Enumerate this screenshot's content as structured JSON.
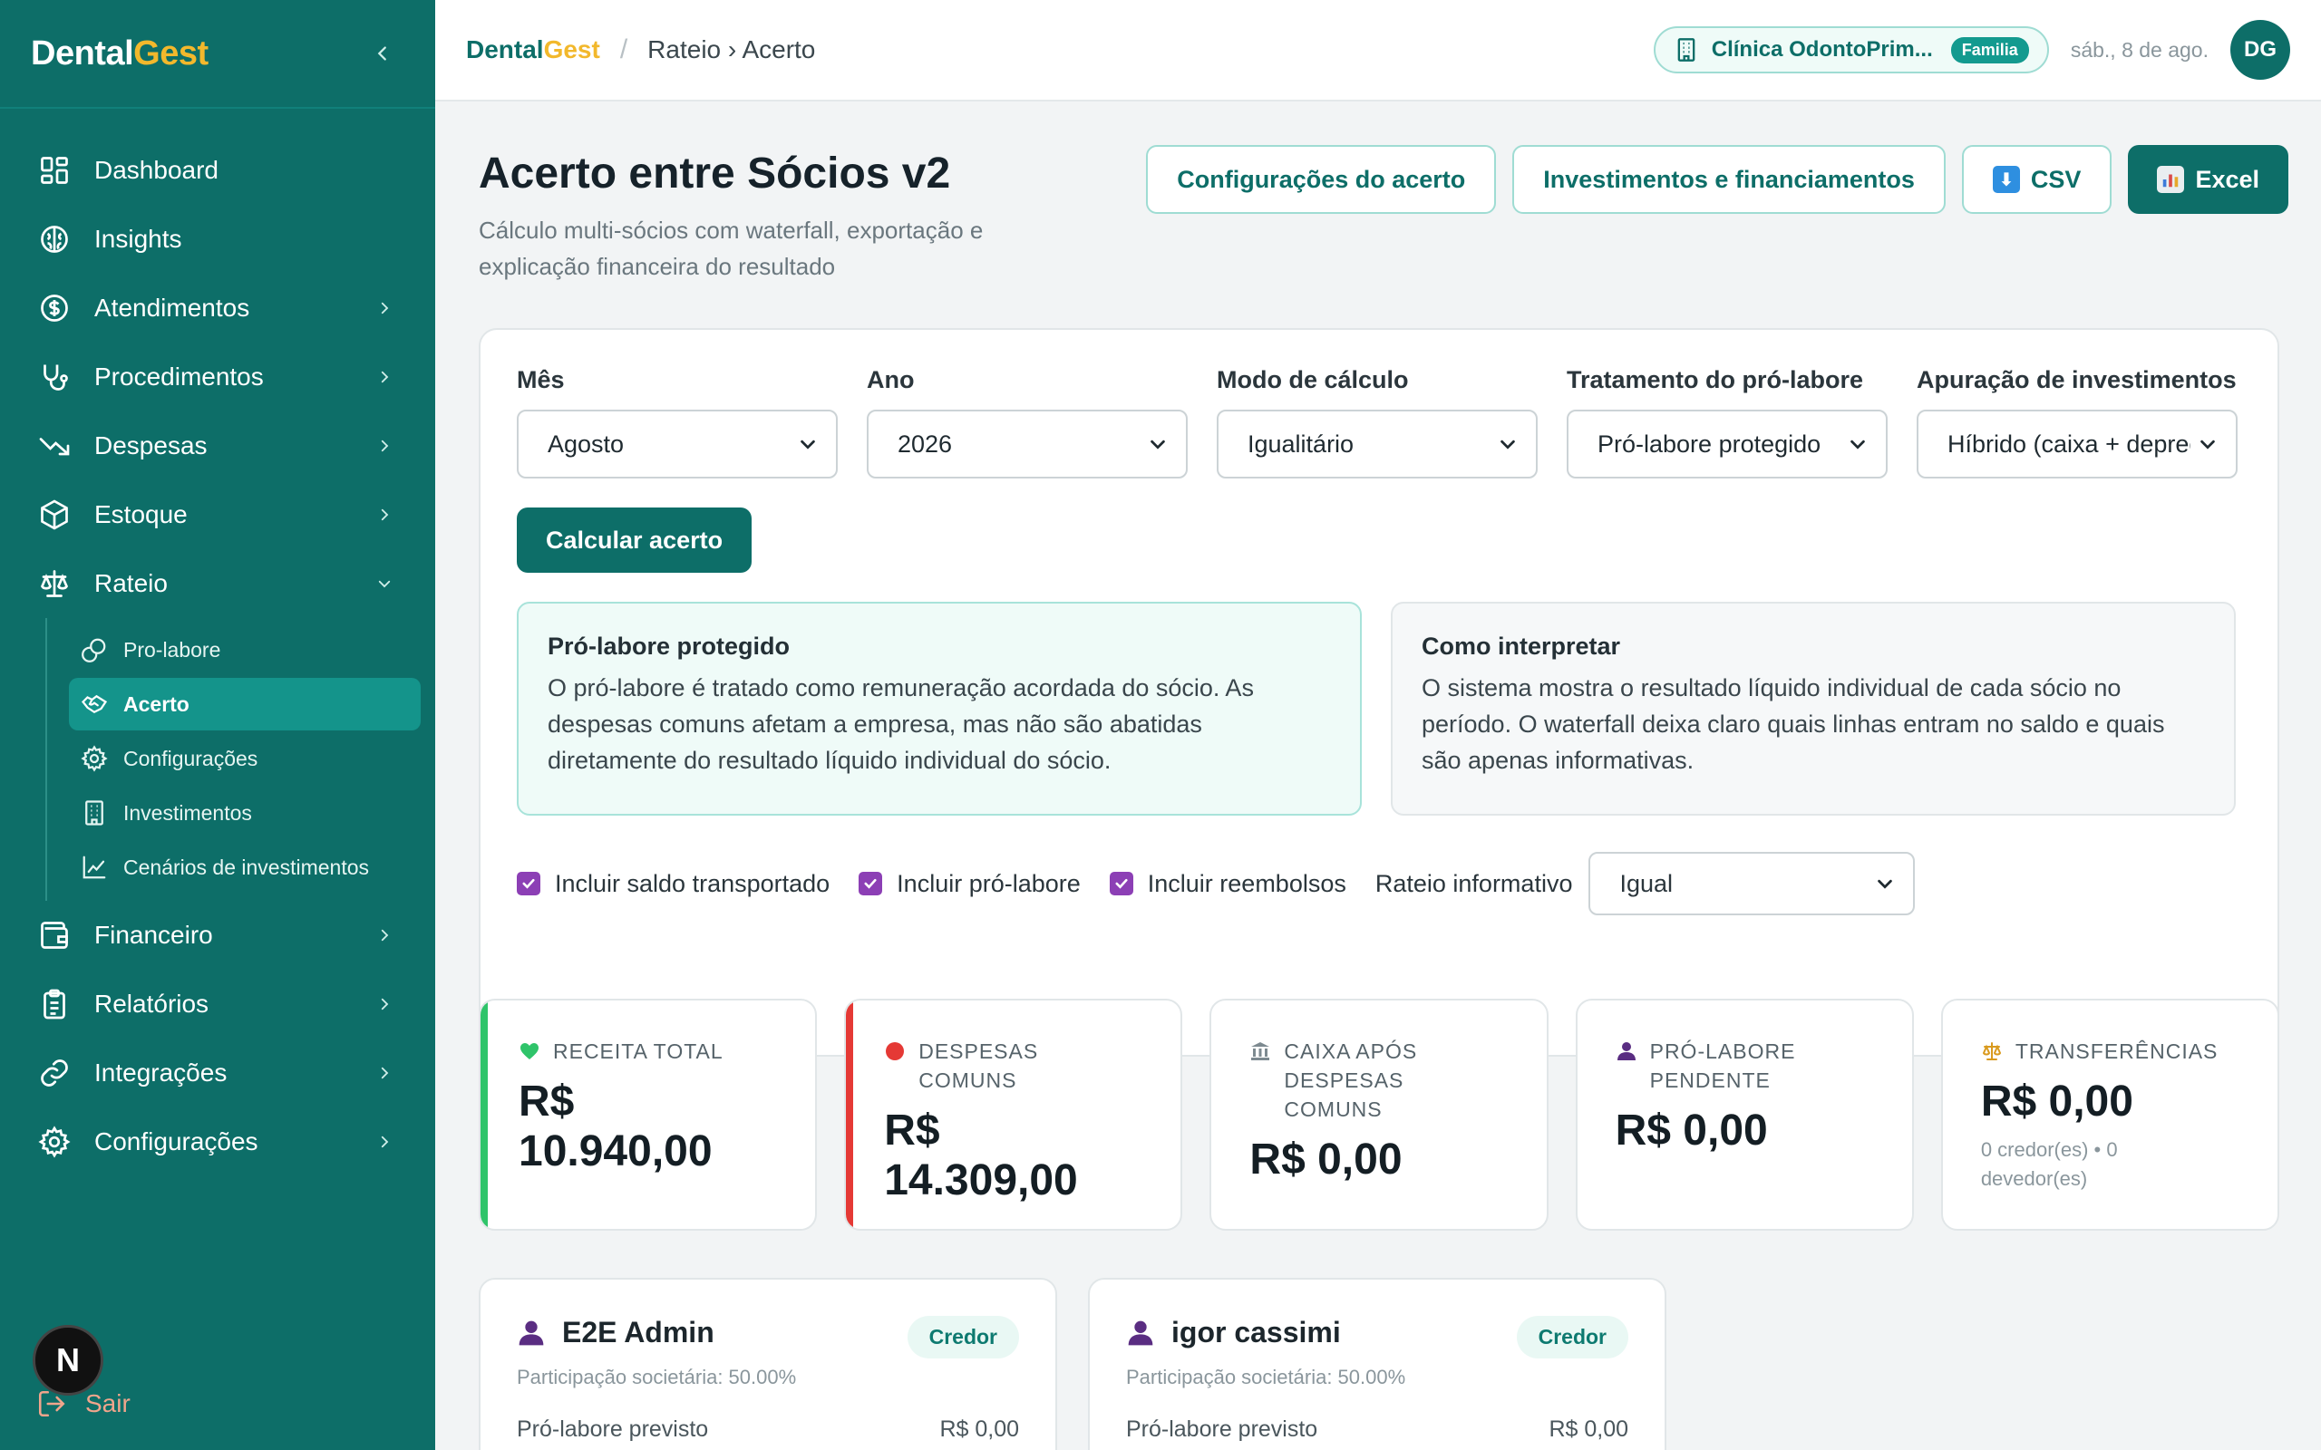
{
  "sidebar": {
    "brand_part1": "Dental",
    "brand_part2": "Gest",
    "items": [
      {
        "label": "Dashboard"
      },
      {
        "label": "Insights"
      },
      {
        "label": "Atendimentos"
      },
      {
        "label": "Procedimentos"
      },
      {
        "label": "Despesas"
      },
      {
        "label": "Estoque"
      },
      {
        "label": "Rateio"
      },
      {
        "label": "Financeiro"
      },
      {
        "label": "Relatórios"
      },
      {
        "label": "Integrações"
      },
      {
        "label": "Configurações"
      }
    ],
    "subitems": [
      {
        "label": "Pro-labore"
      },
      {
        "label": "Acerto"
      },
      {
        "label": "Configurações"
      },
      {
        "label": "Investimentos"
      },
      {
        "label": "Cenários de investimentos"
      }
    ],
    "logout_label": "Sair",
    "badge_letter": "N"
  },
  "topbar": {
    "brand_part1": "Dental",
    "brand_part2": "Gest",
    "separator": "/",
    "page": "Rateio › Acerto",
    "clinic": "Clínica OdontoPrim...",
    "clinic_badge": "Familia",
    "date": "sáb., 8 de ago.",
    "avatar": "DG"
  },
  "page": {
    "title": "Acerto entre Sócios v2",
    "subtitle": "Cálculo multi-sócios com waterfall, exportação e explicação financeira do resultado",
    "actions": {
      "config": "Configurações do acerto",
      "invest": "Investimentos e financiamentos",
      "csv": "CSV",
      "excel": "Excel"
    }
  },
  "filters": {
    "mes": {
      "label": "Mês",
      "value": "Agosto"
    },
    "ano": {
      "label": "Ano",
      "value": "2026"
    },
    "modo": {
      "label": "Modo de cálculo",
      "value": "Igualitário"
    },
    "prolabore": {
      "label": "Tratamento do pró-labore",
      "value": "Pró-labore protegido"
    },
    "apuracao": {
      "label": "Apuração de investimentos",
      "value": "Híbrido (caixa + deprecia"
    },
    "calc_button": "Calcular acerto"
  },
  "info": {
    "green_title": "Pró-labore protegido",
    "green_text": "O pró-labore é tratado como remuneração acordada do sócio. As despesas comuns afetam a empresa, mas não são abatidas diretamente do resultado líquido individual do sócio.",
    "gray_title": "Como interpretar",
    "gray_text": "O sistema mostra o resultado líquido individual de cada sócio no período. O waterfall deixa claro quais linhas entram no saldo e quais são apenas informativas."
  },
  "options": {
    "saldo": "Incluir saldo transportado",
    "prolabore": "Incluir pró-labore",
    "reembolsos": "Incluir reembolsos",
    "rateio_label": "Rateio informativo",
    "rateio_value": "Igual"
  },
  "kpis": [
    {
      "label": "Receita total",
      "value": "R$ 10.940,00",
      "note": ""
    },
    {
      "label": "Despesas comuns",
      "value": "R$ 14.309,00",
      "note": ""
    },
    {
      "label": "Caixa após despesas comuns",
      "value": "R$ 0,00",
      "note": ""
    },
    {
      "label": "Pró-labore pendente",
      "value": "R$ 0,00",
      "note": ""
    },
    {
      "label": "Transferências",
      "value": "R$ 0,00",
      "note": "0 credor(es) • 0 devedor(es)"
    }
  ],
  "partners": [
    {
      "name": "E2E Admin",
      "status": "Credor",
      "share": "Participação societária: 50.00%",
      "row_label": "Pró-labore previsto",
      "row_value": "R$ 0,00"
    },
    {
      "name": "igor cassimi",
      "status": "Credor",
      "share": "Participação societária: 50.00%",
      "row_label": "Pró-labore previsto",
      "row_value": "R$ 0,00"
    }
  ],
  "colors": {
    "sidebar": "#0d6e68",
    "accent": "#0d6e68",
    "brand_yellow": "#f2b82c",
    "checkbox": "#8c3fb5",
    "kpi_green": "#2fc46a",
    "kpi_red": "#e53935"
  }
}
